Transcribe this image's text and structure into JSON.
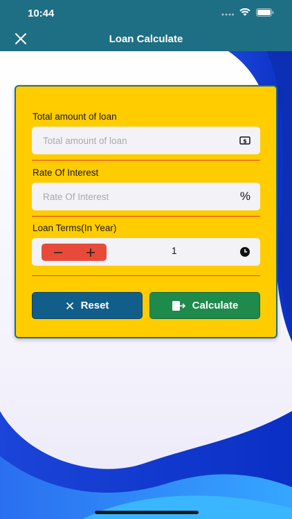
{
  "status": {
    "time": "10:44"
  },
  "nav": {
    "title": "Loan Calculate"
  },
  "form": {
    "loan_amount": {
      "label": "Total amount of loan",
      "placeholder": "Total amount of loan",
      "value": ""
    },
    "interest": {
      "label": "Rate Of Interest",
      "placeholder": "Rate Of Interest",
      "suffix": "%",
      "value": ""
    },
    "terms": {
      "label": "Loan Terms(In Year)",
      "value": "1"
    }
  },
  "buttons": {
    "reset": "Reset",
    "calculate": "Calculate"
  },
  "colors": {
    "header": "#1e6e84",
    "card": "#ffcc00",
    "reset": "#115e8a",
    "calculate": "#1e8a4c",
    "stepper": "#e84a3a",
    "separator": "#e53935"
  },
  "icons": {
    "close": "close-icon",
    "dollar": "dollar-bill-icon",
    "clock": "clock-icon",
    "reset": "x-icon",
    "calculate": "exit-door-icon"
  }
}
